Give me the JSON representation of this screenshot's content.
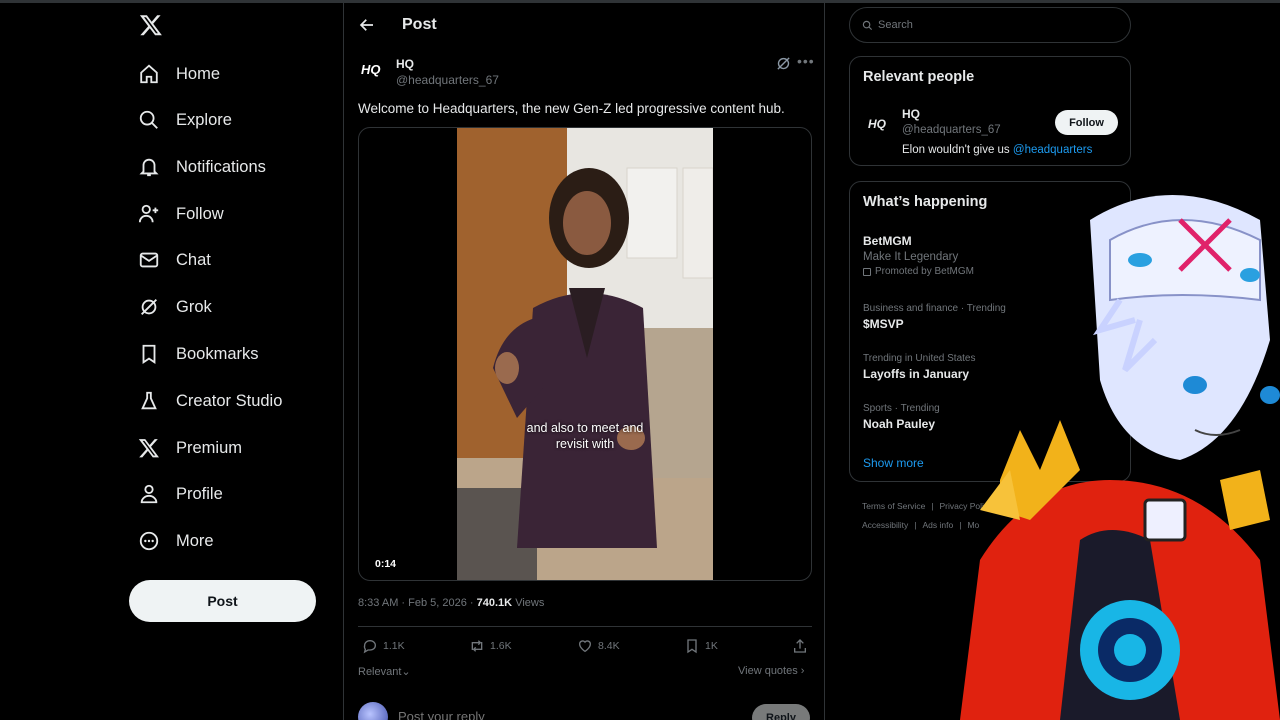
{
  "nav": {
    "items": [
      {
        "label": "Home",
        "icon": "home-icon"
      },
      {
        "label": "Explore",
        "icon": "search-icon"
      },
      {
        "label": "Notifications",
        "icon": "bell-icon"
      },
      {
        "label": "Follow",
        "icon": "person-add-icon"
      },
      {
        "label": "Chat",
        "icon": "mail-icon"
      },
      {
        "label": "Grok",
        "icon": "grok-icon"
      },
      {
        "label": "Bookmarks",
        "icon": "bookmark-icon"
      },
      {
        "label": "Creator Studio",
        "icon": "flask-icon"
      },
      {
        "label": "Premium",
        "icon": "x-logo-icon"
      },
      {
        "label": "Profile",
        "icon": "person-icon"
      },
      {
        "label": "More",
        "icon": "more-circle-icon"
      }
    ],
    "post_button": "Post"
  },
  "header": {
    "title": "Post"
  },
  "tweet": {
    "author_name": "HQ",
    "author_handle": "@headquarters_67",
    "avatar_text": "HQ",
    "text": "Welcome to Headquarters, the new Gen-Z led progressive content hub.",
    "video_caption_line1": "and also to meet and",
    "video_caption_line2": "revisit with",
    "video_duration": "0:14",
    "time": "8:33 AM",
    "date": "Feb 5, 2026",
    "views_count": "740.1K",
    "views_label": "Views",
    "replies": "1.1K",
    "reposts": "1.6K",
    "likes": "8.4K",
    "bookmarks": "1K",
    "sort_label": "Relevant",
    "view_quotes": "View quotes"
  },
  "reply": {
    "placeholder": "Post your reply",
    "button": "Reply"
  },
  "search": {
    "placeholder": "Search"
  },
  "relevant_people": {
    "title": "Relevant people",
    "name": "HQ",
    "handle": "@headquarters_67",
    "bio_prefix": "Elon wouldn't give us",
    "bio_link": "@headquarters",
    "follow": "Follow"
  },
  "happening": {
    "title": "What’s happening",
    "promo_name": "BetMGM",
    "promo_tagline": "Make It Legendary",
    "promo_label": "Promoted by BetMGM",
    "trends": [
      {
        "context": "Business and finance · Trending",
        "name": "$MSVP"
      },
      {
        "context": "Trending in United States",
        "name": "Layoffs in January"
      },
      {
        "context": "Sports · Trending",
        "name": "Noah Pauley"
      }
    ],
    "show_more": "Show more"
  },
  "footer": {
    "row1": [
      "Terms of Service",
      "|",
      "Privacy Policy",
      "|"
    ],
    "row2": [
      "Accessibility",
      "|",
      "Ads info",
      "|",
      "Mo"
    ]
  },
  "colors": {
    "accent": "#1d9bf0",
    "border": "#2f3336",
    "muted": "#71767b"
  }
}
